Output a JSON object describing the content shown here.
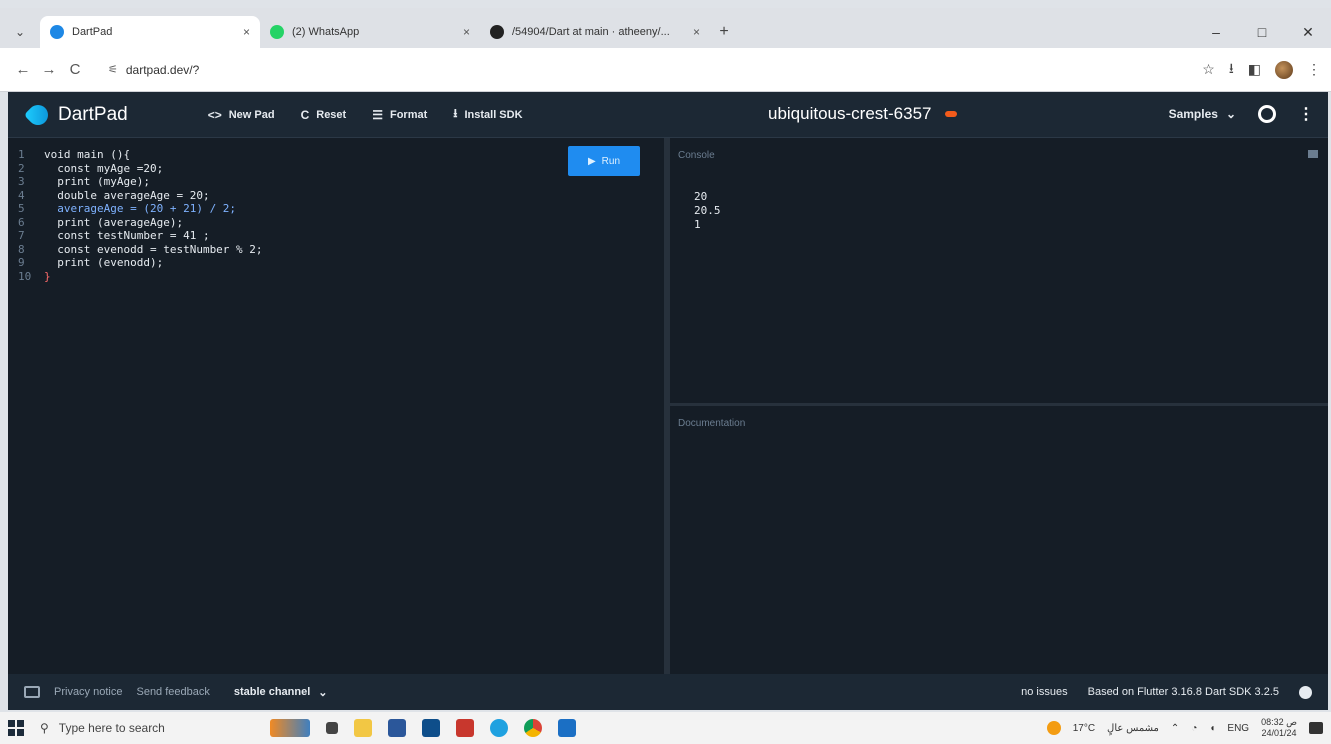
{
  "browser": {
    "tabs": [
      {
        "label": "DartPad",
        "color": "#1e88e5",
        "active": true
      },
      {
        "label": "(2) WhatsApp",
        "color": "#25d366",
        "active": false
      },
      {
        "label": "/54904/Dart at main · atheeny/...",
        "color": "#222222",
        "active": false
      }
    ],
    "tab_close": "×",
    "new_tab": "+",
    "url": "dartpad.dev/?",
    "window_controls": {
      "minimize": "–",
      "maximize": "□",
      "close": "✕"
    },
    "nav": {
      "back": "←",
      "forward": "→",
      "reload": "C"
    }
  },
  "dartpad": {
    "brand": "DartPad",
    "actions": [
      {
        "icon": "<>",
        "label": "New Pad"
      },
      {
        "icon": "C",
        "label": "Reset"
      },
      {
        "icon": "☰",
        "label": "Format"
      },
      {
        "icon": "⭳",
        "label": "Install SDK"
      }
    ],
    "pad_name": "ubiquitous-crest-6357",
    "pad_badge": "",
    "samples_label": "Samples",
    "run_label": "Run",
    "code_lines": [
      {
        "n": "1",
        "text": "void main (){"
      },
      {
        "n": "2",
        "text": "  const myAge =20;"
      },
      {
        "n": "3",
        "text": "  print (myAge);"
      },
      {
        "n": "4",
        "text": "  double averageAge = 20;"
      },
      {
        "n": "5",
        "text": "  averageAge = (20 + 21) / 2;"
      },
      {
        "n": "6",
        "text": "  print (averageAge);"
      },
      {
        "n": "7",
        "text": "  const testNumber = 41 ;"
      },
      {
        "n": "8",
        "text": "  const evenodd = testNumber % 2;"
      },
      {
        "n": "9",
        "text": "  print (evenodd);"
      },
      {
        "n": "10",
        "text": "}"
      }
    ],
    "console_label": "Console",
    "console_output": [
      "20",
      "20.5",
      "1"
    ],
    "docs_label": "Documentation",
    "footer": {
      "privacy": "Privacy notice",
      "feedback": "Send feedback",
      "channel": "stable channel",
      "issues": "no issues",
      "version": "Based on Flutter 3.16.8 Dart SDK 3.2.5"
    }
  },
  "taskbar": {
    "search_placeholder": "Type here to search",
    "weather": "17°C",
    "weather_text": "مشمس عالٍ",
    "lang": "ENG",
    "time": "08:32 ص",
    "date": "24/01/24"
  }
}
